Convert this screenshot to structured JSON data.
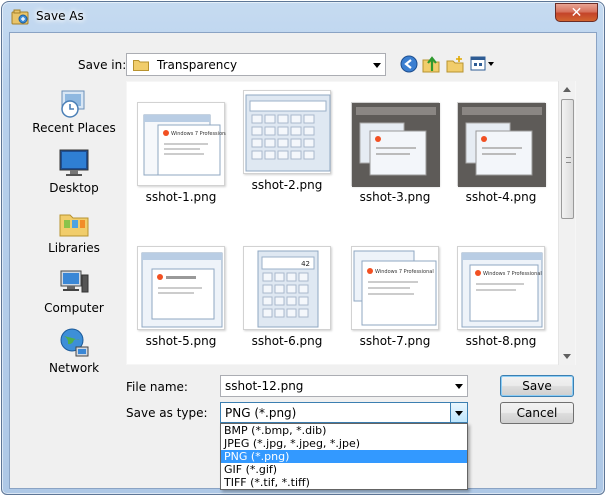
{
  "window": {
    "title": "Save As",
    "close_glyph": "✕"
  },
  "toolbar": {
    "save_in_label": "Save in:",
    "save_in_value": "Transparency",
    "icons": [
      "back-icon",
      "up-folder-icon",
      "new-folder-icon",
      "views-menu-icon"
    ]
  },
  "places": [
    {
      "label": "Recent Places",
      "icon": "recent-places-icon"
    },
    {
      "label": "Desktop",
      "icon": "desktop-icon"
    },
    {
      "label": "Libraries",
      "icon": "libraries-icon"
    },
    {
      "label": "Computer",
      "icon": "computer-icon"
    },
    {
      "label": "Network",
      "icon": "network-icon"
    }
  ],
  "files": [
    {
      "name": "sshot-1.png",
      "kind": "windows-about"
    },
    {
      "name": "sshot-2.png",
      "kind": "calculator"
    },
    {
      "name": "sshot-3.png",
      "kind": "dark-desktop"
    },
    {
      "name": "sshot-4.png",
      "kind": "dark-desktop"
    },
    {
      "name": "sshot-5.png",
      "kind": "windows-about"
    },
    {
      "name": "sshot-6.png",
      "kind": "calculator"
    },
    {
      "name": "sshot-7.png",
      "kind": "windows-about"
    },
    {
      "name": "sshot-8.png",
      "kind": "windows-about"
    }
  ],
  "thumb_texts": {
    "windows_logo": "Windows 7 Professional",
    "calc_display": "42"
  },
  "form": {
    "file_name_label": "File name:",
    "file_name_value": "sshot-12.png",
    "save_as_type_label": "Save as type:",
    "save_as_type_value": "PNG (*.png)"
  },
  "buttons": {
    "save": "Save",
    "cancel": "Cancel"
  },
  "type_options": [
    {
      "label": "BMP (*.bmp, *.dib)",
      "selected": false
    },
    {
      "label": "JPEG (*.jpg, *.jpeg, *.jpe)",
      "selected": false
    },
    {
      "label": "PNG (*.png)",
      "selected": true
    },
    {
      "label": "GIF (*.gif)",
      "selected": false
    },
    {
      "label": "TIFF (*.tif, *.tiff)",
      "selected": false
    }
  ]
}
